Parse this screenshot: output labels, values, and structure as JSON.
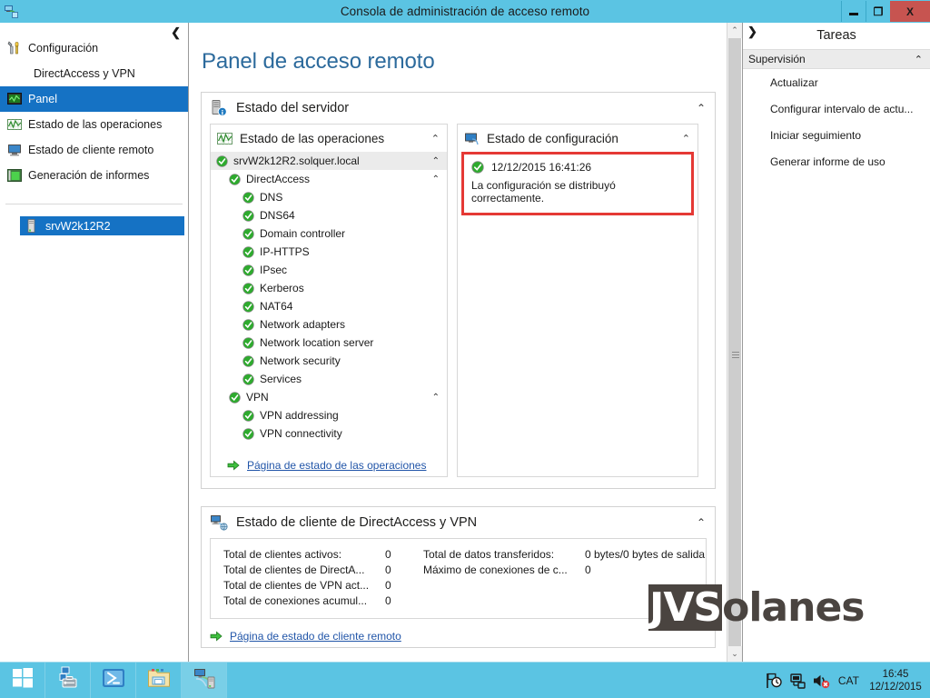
{
  "window": {
    "title": "Consola de administración de acceso remoto",
    "app_icon": "remote-access-icon",
    "minimize_label": "",
    "restore_label": "❐",
    "close_label": "X"
  },
  "sidebar": {
    "collapse_label": "❮",
    "items": [
      {
        "label": "Configuración",
        "icon": "configuration-icon",
        "selected": false,
        "sub": false
      },
      {
        "label": "DirectAccess y VPN",
        "icon": "",
        "selected": false,
        "sub": true
      },
      {
        "label": "Panel",
        "icon": "dashboard-icon",
        "selected": true,
        "sub": false
      },
      {
        "label": "Estado de las operaciones",
        "icon": "operations-status-icon",
        "selected": false,
        "sub": false
      },
      {
        "label": "Estado de cliente remoto",
        "icon": "remote-client-icon",
        "selected": false,
        "sub": false
      },
      {
        "label": "Generación de informes",
        "icon": "reporting-icon",
        "selected": false,
        "sub": false
      }
    ],
    "server": {
      "label": "srvW2k12R2",
      "icon": "server-icon"
    }
  },
  "main": {
    "page_title": "Panel de acceso remoto",
    "server_status": {
      "title": "Estado del servidor",
      "icon": "server-status-icon",
      "chevron": "⌃",
      "operations": {
        "title": "Estado de las operaciones",
        "icon": "operations-chart-icon",
        "chevron": "⌃",
        "tree": [
          {
            "label": "srvW2k12R2.solquer.local",
            "level": 0,
            "status": "ok",
            "chevron": "⌃"
          },
          {
            "label": "DirectAccess",
            "level": 1,
            "status": "ok",
            "chevron": "⌃"
          },
          {
            "label": "DNS",
            "level": 2,
            "status": "ok",
            "chevron": ""
          },
          {
            "label": "DNS64",
            "level": 2,
            "status": "ok",
            "chevron": ""
          },
          {
            "label": "Domain controller",
            "level": 2,
            "status": "ok",
            "chevron": ""
          },
          {
            "label": "IP-HTTPS",
            "level": 2,
            "status": "ok",
            "chevron": ""
          },
          {
            "label": "IPsec",
            "level": 2,
            "status": "ok",
            "chevron": ""
          },
          {
            "label": "Kerberos",
            "level": 2,
            "status": "ok",
            "chevron": ""
          },
          {
            "label": "NAT64",
            "level": 2,
            "status": "ok",
            "chevron": ""
          },
          {
            "label": "Network adapters",
            "level": 2,
            "status": "ok",
            "chevron": ""
          },
          {
            "label": "Network location server",
            "level": 2,
            "status": "ok",
            "chevron": ""
          },
          {
            "label": "Network security",
            "level": 2,
            "status": "ok",
            "chevron": ""
          },
          {
            "label": "Services",
            "level": 2,
            "status": "ok",
            "chevron": ""
          },
          {
            "label": "VPN",
            "level": 1,
            "status": "ok",
            "chevron": "⌃"
          },
          {
            "label": "VPN addressing",
            "level": 2,
            "status": "ok",
            "chevron": ""
          },
          {
            "label": "VPN connectivity",
            "level": 2,
            "status": "ok",
            "chevron": ""
          }
        ],
        "link": "Página de estado de las operaciones"
      },
      "configuration": {
        "title": "Estado de configuración",
        "icon": "configuration-status-icon",
        "chevron": "⌃",
        "timestamp": "12/12/2015 16:41:26",
        "message": "La configuración se distribuyó correctamente.",
        "highlight_color": "#e53935"
      }
    },
    "client_status": {
      "title": "Estado de cliente de DirectAccess y VPN",
      "icon": "client-status-icon",
      "chevron": "⌃",
      "stats": [
        {
          "label": "Total de clientes activos:",
          "value": "0",
          "label2": "Total de datos transferidos:",
          "value2": "0 bytes/0 bytes de salida"
        },
        {
          "label": "Total de clientes de DirectA...",
          "value": "0",
          "label2": "Máximo de conexiones de c...",
          "value2": "0"
        },
        {
          "label": "Total de clientes de VPN act...",
          "value": "0",
          "label2": "",
          "value2": ""
        },
        {
          "label": "Total de conexiones acumul...",
          "value": "0",
          "label2": "",
          "value2": ""
        }
      ],
      "link": "Página de estado de cliente remoto"
    }
  },
  "tasks": {
    "expand_label": "❯",
    "title": "Tareas",
    "group": {
      "label": "Supervisión",
      "chevron": "⌃"
    },
    "items": [
      {
        "label": "Actualizar"
      },
      {
        "label": "Configurar intervalo de actu..."
      },
      {
        "label": "Iniciar seguimiento"
      },
      {
        "label": "Generar informe de uso"
      }
    ]
  },
  "watermark": {
    "part1": "JVS",
    "part2": "olanes"
  },
  "taskbar": {
    "buttons": [
      {
        "icon": "windows-start-icon",
        "name": "start-button",
        "active": false
      },
      {
        "icon": "server-manager-icon",
        "name": "server-manager-button",
        "active": false
      },
      {
        "icon": "powershell-icon",
        "name": "powershell-button",
        "active": false
      },
      {
        "icon": "file-explorer-icon",
        "name": "file-explorer-button",
        "active": false
      },
      {
        "icon": "remote-access-console-icon",
        "name": "remote-access-console-button",
        "active": true
      }
    ],
    "tray": {
      "icons": [
        "flag-clock-icon",
        "network-icon",
        "volume-muted-icon"
      ],
      "language": "CAT",
      "time": "16:45",
      "date": "12/12/2015"
    }
  },
  "scrollbar": {
    "up": "⌃",
    "down": "⌄"
  }
}
